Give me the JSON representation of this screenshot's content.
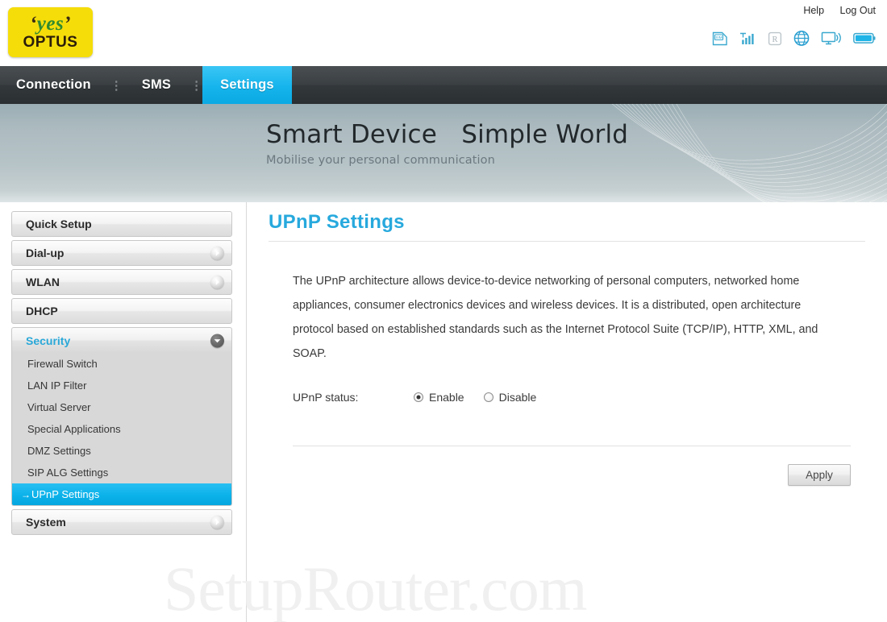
{
  "header": {
    "logo": {
      "yes": "yes",
      "brand": "OPTUS",
      "quote_open": "‘",
      "quote_close": "’"
    },
    "links": [
      {
        "label": "Help",
        "name": "help-link"
      },
      {
        "label": "Log Out",
        "name": "logout-link"
      }
    ],
    "status_icons": [
      {
        "name": "sim-card-icon",
        "label": "SIM",
        "state": "active"
      },
      {
        "name": "signal-strength-icon",
        "label": "Signal",
        "state": "active"
      },
      {
        "name": "roaming-icon",
        "label": "R",
        "state": "inactive"
      },
      {
        "name": "globe-internet-icon",
        "label": "Internet",
        "state": "active"
      },
      {
        "name": "wifi-monitor-icon",
        "label": "WiFi",
        "state": "active"
      },
      {
        "name": "battery-icon",
        "label": "Battery",
        "state": "active"
      }
    ]
  },
  "nav": {
    "separator": "⋮",
    "items": [
      {
        "label": "Connection",
        "active": false
      },
      {
        "label": "SMS",
        "active": false
      },
      {
        "label": "Settings",
        "active": true
      }
    ]
  },
  "banner": {
    "title": "Smart Device   Simple World",
    "subtitle": "Mobilise your personal communication"
  },
  "sidebar": {
    "items": [
      {
        "label": "Quick Setup",
        "arrow": "none",
        "expanded": false
      },
      {
        "label": "Dial-up",
        "arrow": "right",
        "expanded": false
      },
      {
        "label": "WLAN",
        "arrow": "right",
        "expanded": false
      },
      {
        "label": "DHCP",
        "arrow": "none",
        "expanded": false
      },
      {
        "label": "Security",
        "arrow": "down",
        "expanded": true
      },
      {
        "label": "System",
        "arrow": "right",
        "expanded": false
      }
    ],
    "security_submenu": [
      {
        "label": "Firewall Switch",
        "active": false
      },
      {
        "label": "LAN IP Filter",
        "active": false
      },
      {
        "label": "Virtual Server",
        "active": false
      },
      {
        "label": "Special Applications",
        "active": false
      },
      {
        "label": "DMZ Settings",
        "active": false
      },
      {
        "label": "SIP ALG Settings",
        "active": false
      },
      {
        "label": "UPnP Settings",
        "active": true,
        "arrow_mark": "→"
      }
    ]
  },
  "main": {
    "title": "UPnP Settings",
    "description": "The UPnP architecture allows device-to-device networking of personal computers, networked home appliances, consumer electronics devices and wireless devices. It is a distributed, open architecture protocol based on established standards such as the Internet Protocol Suite (TCP/IP), HTTP, XML, and SOAP.",
    "status_label": "UPnP status:",
    "options": [
      {
        "label": "Enable",
        "checked": true
      },
      {
        "label": "Disable",
        "checked": false
      }
    ],
    "apply_label": "Apply"
  },
  "watermark": {
    "text": "SetupRouter.com"
  },
  "colors": {
    "accent_cyan": "#0bb2ea",
    "title_blue": "#27a9dd",
    "logo_yellow": "#f5dd0a",
    "logo_green": "#2f8a2f",
    "nav_dark": "#3b4043",
    "banner_gray": "#b6c3c7"
  }
}
